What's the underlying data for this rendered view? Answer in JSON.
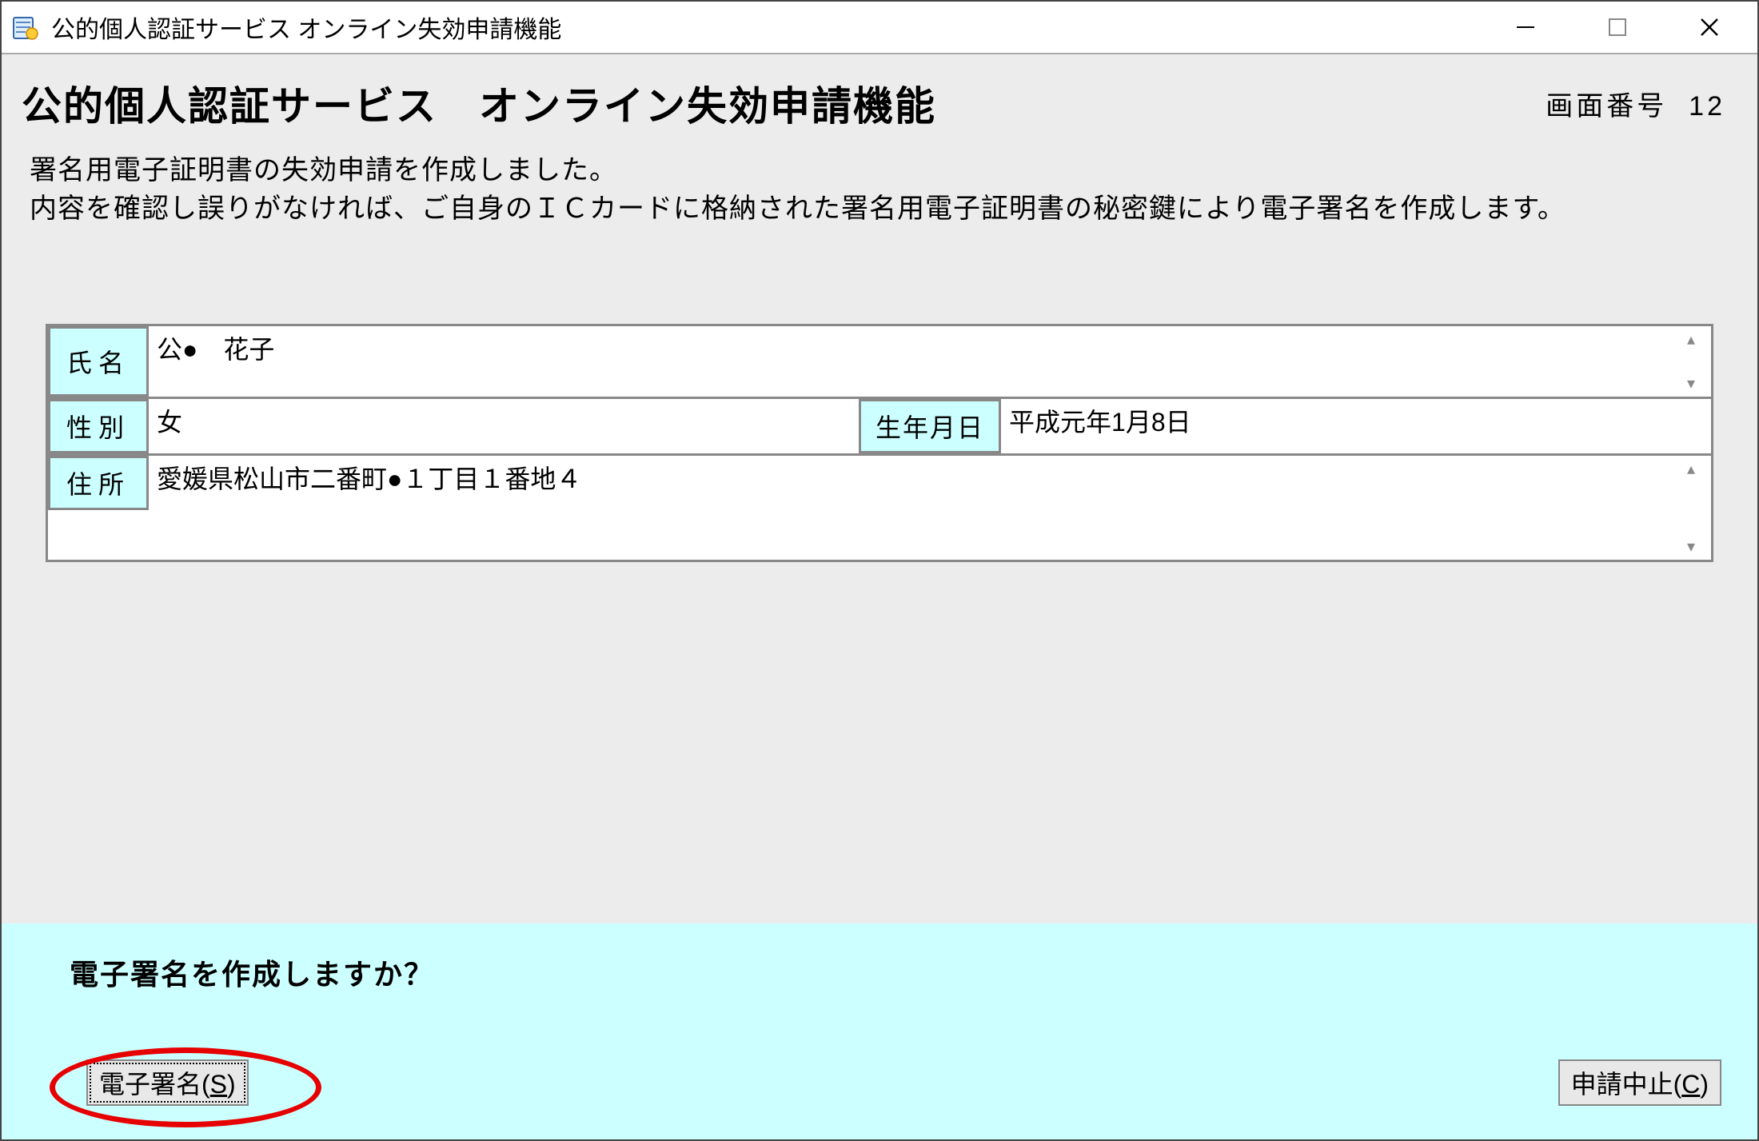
{
  "titlebar": {
    "title": "公的個人認証サービス オンライン失効申請機能"
  },
  "header": {
    "title": "公的個人認証サービス　オンライン失効申請機能",
    "screen_number_label": "画面番号",
    "screen_number": "12"
  },
  "instructions": {
    "line1": "署名用電子証明書の失効申請を作成しました。",
    "line2": "内容を確認し誤りがなければ、ご自身のＩＣカードに格納された署名用電子証明書の秘密鍵により電子署名を作成します。"
  },
  "form": {
    "name_label": "氏名",
    "name_value": "公●　花子",
    "gender_label": "性別",
    "gender_value": "女",
    "dob_label": "生年月日",
    "dob_value": "平成元年1月8日",
    "address_label": "住所",
    "address_value": "愛媛県松山市二番町●１丁目１番地４"
  },
  "footer": {
    "prompt": "電子署名を作成しますか？",
    "sign_prefix": "電子署名(",
    "sign_key": "S",
    "sign_suffix": ")",
    "cancel_prefix": "申請中止(",
    "cancel_key": "C",
    "cancel_suffix": ")"
  }
}
